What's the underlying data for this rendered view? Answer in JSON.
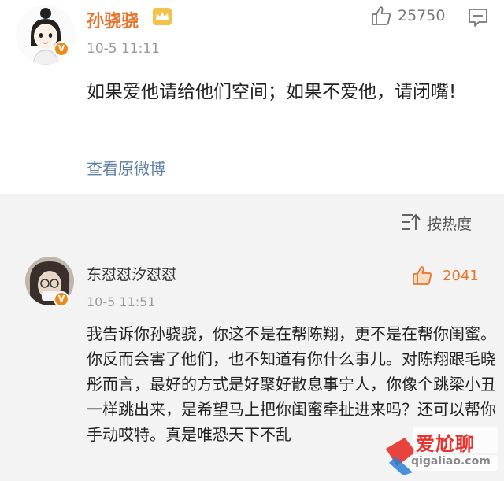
{
  "post": {
    "author": "孙骁骁",
    "timestamp": "10-5 11:11",
    "like_count": "25750",
    "content": "如果爱他请给他们空间；如果不爱他，请闭嘴!",
    "view_original": "查看原微博",
    "verified_badge": "V",
    "icons": [
      "thumbs-up-icon",
      "comment-icon",
      "crown-icon",
      "verified-icon"
    ]
  },
  "sort": {
    "label": "按热度",
    "icon": "sort-icon"
  },
  "comment": {
    "author": "东怼怼汐怼怼",
    "timestamp": "10-5 11:51",
    "like_count": "2041",
    "content": "我告诉你孙骁骁，你这不是在帮陈翔，更不是在帮你闺蜜。你反而会害了他们，也不知道有你什么事儿。对陈翔跟毛晓彤而言，最好的方式是好聚好散息事宁人，你像个跳梁小丑一样跳出来，是希望马上把你闺蜜牵扯进来吗？还可以帮你手动哎特。真是唯恐天下不乱",
    "verified_badge": "V"
  },
  "watermark": {
    "text": "爱尬聊",
    "url": "qigaliao.com"
  },
  "colors": {
    "author_orange": "#e8742c",
    "link_blue": "#5c7fa3",
    "badge_orange": "#ee8a1a",
    "watermark_red": "#e8302c"
  }
}
